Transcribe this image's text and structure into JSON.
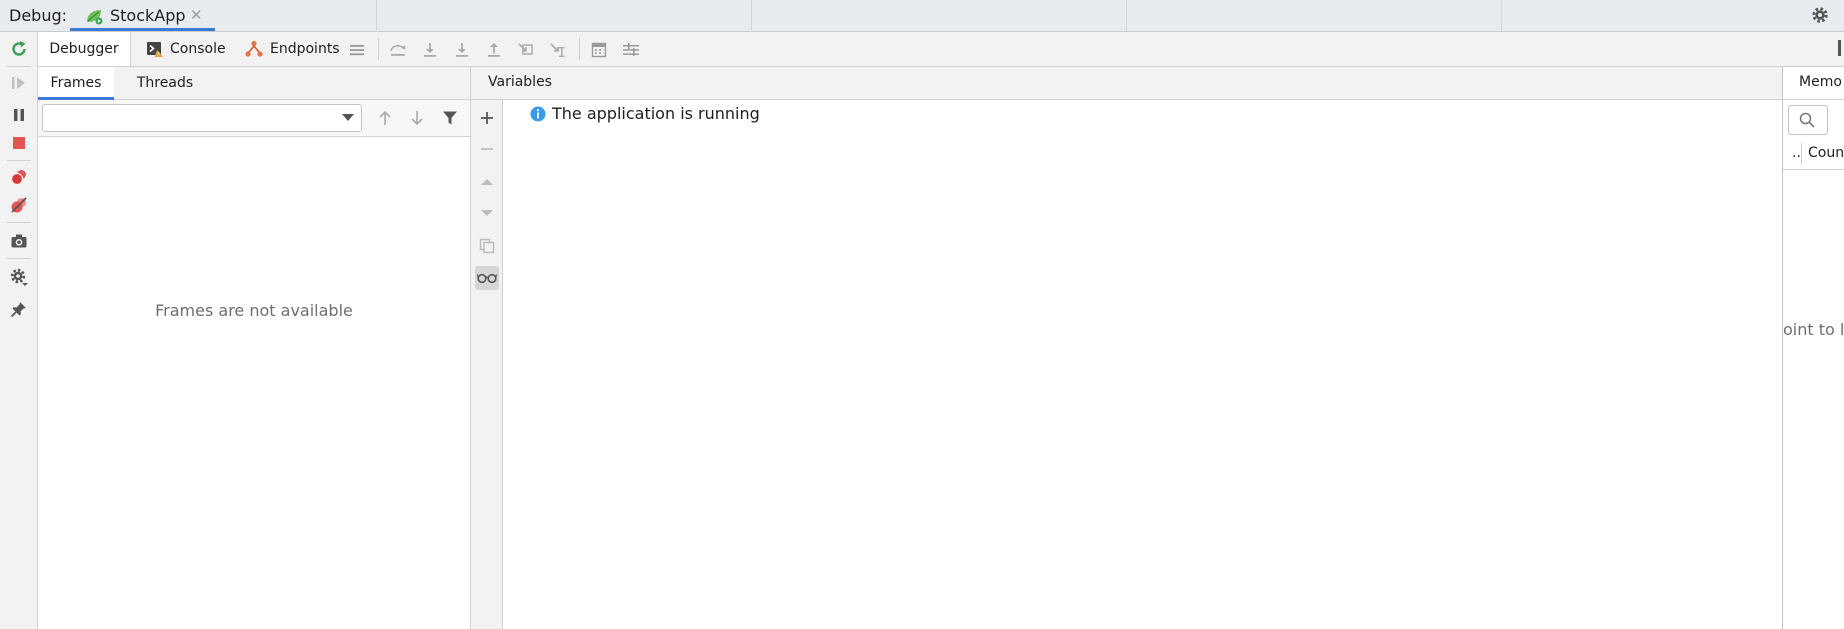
{
  "top_bar": {
    "debug_label": "Debug:",
    "run_tab": {
      "label": "StockApp",
      "close": "✕",
      "icon": "spring-boot-run-icon"
    },
    "settings_icon": "gear-icon"
  },
  "left_toolbar": {
    "items": [
      "rerun-icon",
      "resume-icon",
      "pause-icon",
      "stop-icon",
      "view-breakpoints-icon",
      "mute-breakpoints-icon",
      "camera-icon",
      "settings-icon",
      "pin-icon"
    ]
  },
  "debugger_toolbar": {
    "tabs": [
      {
        "label": "Debugger",
        "active": true
      },
      {
        "label": "Console",
        "icon": "console-warning-icon"
      },
      {
        "label": "Endpoints",
        "icon": "endpoints-icon"
      }
    ],
    "actions": [
      "menu-icon",
      "step-over-icon",
      "step-into-icon",
      "force-step-into-icon",
      "step-out-icon",
      "drop-frame-icon",
      "run-to-cursor-icon",
      "evaluate-expression-icon",
      "trace-icon"
    ]
  },
  "frames_panel": {
    "tabs": [
      {
        "label": "Frames",
        "active": true
      },
      {
        "label": "Threads"
      }
    ],
    "thread_select_value": "",
    "empty_message": "Frames are not available"
  },
  "variables_panel": {
    "title": "Variables",
    "status_message": "The application is running",
    "watch_tools": [
      "add-watch-icon",
      "remove-watch-icon",
      "move-up-icon",
      "move-down-icon",
      "duplicate-icon",
      "glasses-icon"
    ]
  },
  "memory_panel": {
    "tab_label": "Memo",
    "column_dots": "..",
    "column_count": "Coun",
    "hint": "oint to lo"
  },
  "colors": {
    "accent": "#3d7ad6",
    "green": "#3e9e51",
    "red": "#e55454",
    "info": "#3d9ae8"
  }
}
